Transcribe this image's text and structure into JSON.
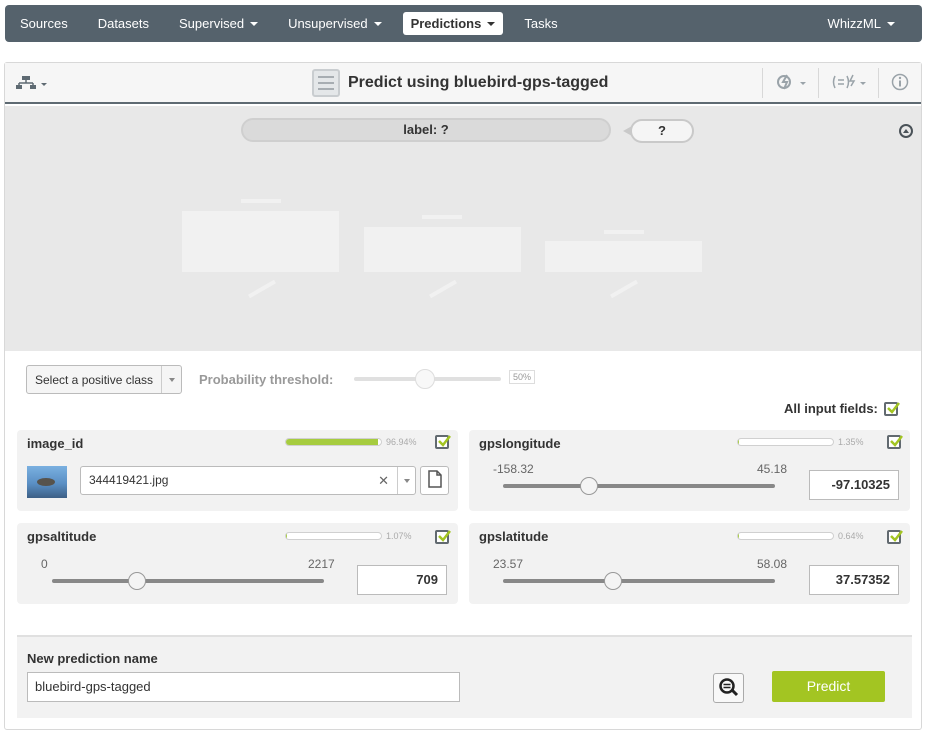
{
  "nav": {
    "items": [
      "Sources",
      "Datasets",
      "Supervised",
      "Unsupervised",
      "Predictions",
      "Tasks"
    ],
    "user": "WhizzML"
  },
  "toolbar": {
    "title": "Predict using bluebird-gps-tagged"
  },
  "result": {
    "label_text": "label: ?",
    "answer": "?"
  },
  "controls": {
    "positive_class_placeholder": "Select a positive class",
    "threshold_label": "Probability threshold:",
    "threshold_value": "50%",
    "threshold_fraction": 0.5,
    "all_fields_label": "All input fields:"
  },
  "fields": {
    "image_id": {
      "name": "image_id",
      "importance": "96.94%",
      "importance_fraction": 0.9694,
      "value": "344419421.jpg"
    },
    "gpslongitude": {
      "name": "gpslongitude",
      "importance": "1.35%",
      "importance_fraction": 0.0135,
      "min": "-158.32",
      "max": "45.18",
      "value": "-97.10325"
    },
    "gpsaltitude": {
      "name": "gpsaltitude",
      "importance": "1.07%",
      "importance_fraction": 0.0107,
      "min": "0",
      "max": "2217",
      "value": "709"
    },
    "gpslatitude": {
      "name": "gpslatitude",
      "importance": "0.64%",
      "importance_fraction": 0.0064,
      "min": "23.57",
      "max": "58.08",
      "value": "37.57352"
    }
  },
  "bottom": {
    "name_label": "New prediction name",
    "name_value": "bluebird-gps-tagged",
    "predict_label": "Predict"
  },
  "colors": {
    "nav_bg": "#55626c",
    "accent_green": "#a3c522",
    "importance_green": "#a6cc3f"
  }
}
